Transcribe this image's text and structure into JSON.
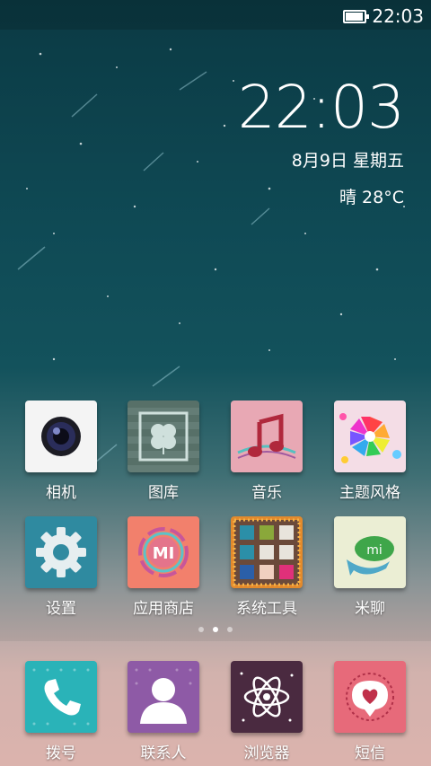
{
  "status_bar": {
    "time": "22:03",
    "battery_icon": "battery-icon"
  },
  "clock_widget": {
    "time": "22:03",
    "date": "8月9日 星期五",
    "weather": "晴 28°C"
  },
  "apps_row1": [
    {
      "name": "camera-app",
      "label": "相机",
      "icon": "camera-icon"
    },
    {
      "name": "gallery-app",
      "label": "图库",
      "icon": "clover-icon"
    },
    {
      "name": "music-app",
      "label": "音乐",
      "icon": "music-note-icon"
    },
    {
      "name": "themes-app",
      "label": "主题风格",
      "icon": "color-petals-icon"
    }
  ],
  "apps_row2": [
    {
      "name": "settings-app",
      "label": "设置",
      "icon": "gear-icon"
    },
    {
      "name": "app-store-app",
      "label": "应用商店",
      "icon": "mi-ring-icon",
      "badge": "MI"
    },
    {
      "name": "system-tools-app",
      "label": "系统工具",
      "icon": "folder-icon"
    },
    {
      "name": "miliao-app",
      "label": "米聊",
      "icon": "chat-bubble-icon",
      "badge": "mi"
    }
  ],
  "page_indicator": {
    "pages": 3,
    "active": 2
  },
  "dock": [
    {
      "name": "dialer-app",
      "label": "拨号",
      "icon": "phone-icon"
    },
    {
      "name": "contacts-app",
      "label": "联系人",
      "icon": "person-icon"
    },
    {
      "name": "browser-app",
      "label": "浏览器",
      "icon": "atom-icon"
    },
    {
      "name": "sms-app",
      "label": "短信",
      "icon": "heart-bubble-icon"
    }
  ]
}
